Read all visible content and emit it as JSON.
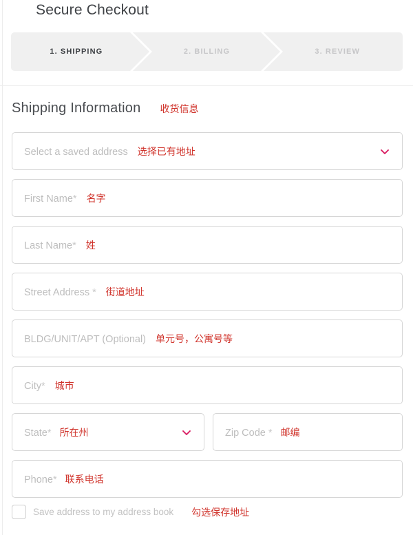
{
  "page": {
    "title": "Secure Checkout"
  },
  "stepper": {
    "steps": [
      {
        "label": "1. SHIPPING",
        "state": "active"
      },
      {
        "label": "2. BILLING",
        "state": "inactive"
      },
      {
        "label": "3. REVIEW",
        "state": "inactive"
      }
    ]
  },
  "section": {
    "title": "Shipping Information",
    "annotation": "收货信息"
  },
  "saved_address": {
    "placeholder": "Select a saved address",
    "annotation": "选择已有地址",
    "icon": "chevron-down-icon"
  },
  "fields": [
    {
      "placeholder": "First Name",
      "required": "*",
      "annotation": "名字"
    },
    {
      "placeholder": "Last Name",
      "required": "*",
      "annotation": "姓"
    },
    {
      "placeholder": "Street Address",
      "required": "*",
      "annotation": "街道地址"
    },
    {
      "placeholder": "BLDG/UNIT/APT (Optional)",
      "required": "",
      "annotation": "单元号，公寓号等"
    },
    {
      "placeholder": "City",
      "required": "*",
      "annotation": "城市"
    },
    {
      "placeholder": "State",
      "required": "*",
      "annotation": "所在州"
    },
    {
      "placeholder": "Zip Code",
      "required": "*",
      "annotation": "邮编"
    },
    {
      "placeholder": "Phone",
      "required": "*",
      "annotation": "联系电话"
    }
  ],
  "save_address": {
    "label": "Save address to my address book",
    "annotation": "勾选保存地址",
    "checked": false
  },
  "colors": {
    "annotation_red": "#d0342c",
    "chevron_pink": "#d81b60",
    "stepper_bg": "#f0f0f0",
    "field_border": "#d6d6d6",
    "placeholder": "#bdbdbd",
    "title": "#3f4246"
  }
}
